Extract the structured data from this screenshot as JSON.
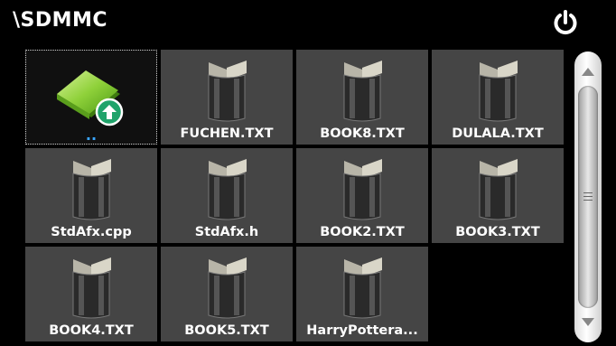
{
  "title": {
    "path": "\\SDMMC"
  },
  "icons": {
    "power": "power-icon",
    "folder_up": "folder-up-icon",
    "book": "book-icon"
  },
  "files": [
    {
      "label": "..",
      "kind": "parent-folder",
      "selected": true
    },
    {
      "label": "FUCHEN.TXT",
      "kind": "book"
    },
    {
      "label": "BOOK8.TXT",
      "kind": "book"
    },
    {
      "label": "DULALA.TXT",
      "kind": "book"
    },
    {
      "label": "StdAfx.cpp",
      "kind": "book"
    },
    {
      "label": "StdAfx.h",
      "kind": "book"
    },
    {
      "label": "BOOK2.TXT",
      "kind": "book"
    },
    {
      "label": "BOOK3.TXT",
      "kind": "book"
    },
    {
      "label": "BOOK4.TXT",
      "kind": "book"
    },
    {
      "label": "BOOK5.TXT",
      "kind": "book"
    },
    {
      "label": "HarryPottera...",
      "kind": "book"
    }
  ],
  "colors": {
    "background": "#000000",
    "tile": "#454545",
    "selected_tile": "#101010",
    "text": "#ffffff",
    "accent": "#3aa6ff"
  }
}
